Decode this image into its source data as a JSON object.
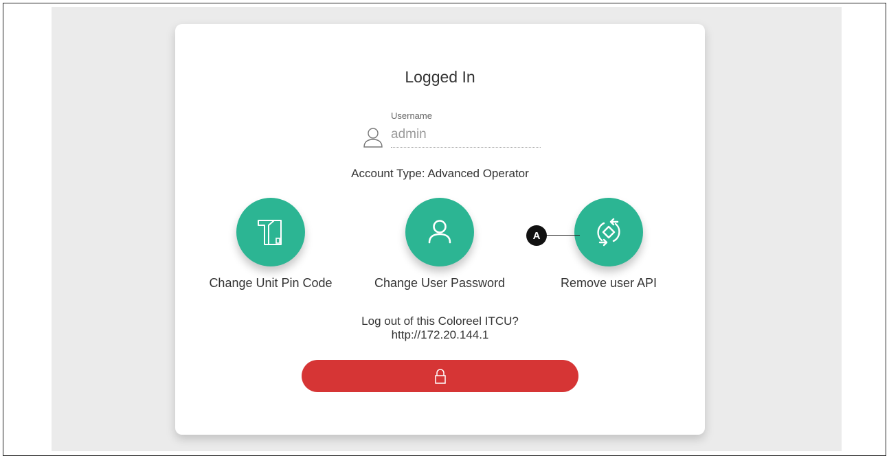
{
  "dialog": {
    "title": "Logged In",
    "username_label": "Username",
    "username_value": "admin",
    "account_type": "Account Type: Advanced Operator"
  },
  "actions": [
    {
      "label": "Change Unit Pin Code",
      "icon": "unit-pin-icon"
    },
    {
      "label": "Change User Password",
      "icon": "user-icon"
    },
    {
      "label": "Remove user API",
      "icon": "api-sync-icon"
    }
  ],
  "logout": {
    "question": "Log out of this Coloreel ITCU?",
    "url": "http://172.20.144.1",
    "button_icon": "lock-icon"
  },
  "callout": {
    "label": "A"
  },
  "colors": {
    "accent": "#2cb593",
    "danger": "#d63535",
    "page_background": "#ebebeb",
    "card": "#ffffff"
  }
}
